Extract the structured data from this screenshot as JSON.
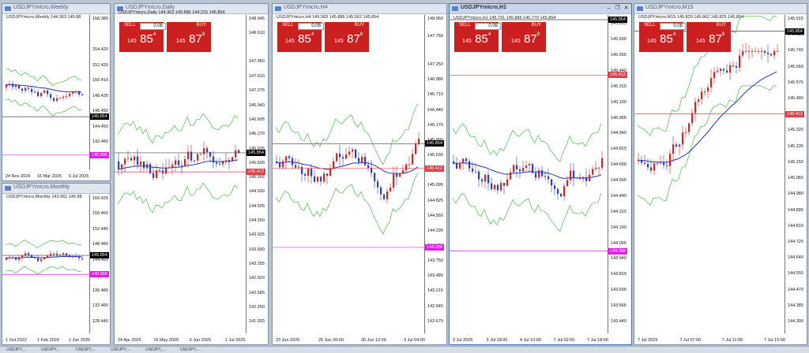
{
  "windows": {
    "weekly": {
      "title": "USDJPYmicro,Weekly",
      "symline": "USDJPYmicro,Weekly  144.363 145.88",
      "ticks": [
        "158.380",
        "154.420",
        "152.420",
        "150.410",
        "148.430",
        "146.450",
        "144.450",
        "142.460",
        "140.470"
      ],
      "xlabels": [
        "24 Nov 2024",
        "16 Mar 2025",
        "6 Jul 2025"
      ],
      "price_tag": "145.854",
      "level_tag": "140.896"
    },
    "monthly": {
      "title": "USDJPYmicro,Monthly",
      "symline": "USDJPYmicro,Monthly  143.961 145.88",
      "ticks": [
        "160.420",
        "156.460",
        "152.440",
        "148.480",
        "144.460",
        "140.440",
        "136.480",
        "132.460",
        "128.440"
      ],
      "xlabels": [
        "1 Oct 2022",
        "1 Feb 2024",
        "1 Jun 2025"
      ],
      "price_tag": "145.854",
      "level_tag": "140.896"
    },
    "daily": {
      "title": "USDJPYmicro,Daily",
      "symline": "USDJPYmicro,Daily  144.363 145.886 144.215 145.854",
      "ticks": [
        "148.945",
        "148.610",
        "147.960",
        "147.610",
        "147.275",
        "146.940",
        "146.605",
        "146.270",
        "145.935",
        "145.600",
        "145.265",
        "144.930",
        "144.595",
        "144.260",
        "143.925",
        "143.590",
        "143.255",
        "142.920",
        "142.585",
        "142.250",
        "141.920"
      ],
      "xlabels": [
        "24 Apr 2025",
        "16 May 2025",
        "9 Jun 2025",
        "1 Jul 2025"
      ],
      "price_tag": "145.854",
      "level_tag": "145.412"
    },
    "h4": {
      "title": "USDJPYmicro,H4",
      "symline": "USDJPYmicro,H4  145.583 145.886 145.562 145.854",
      "ticks": [
        "148.060",
        "147.750",
        "147.250",
        "146.980",
        "146.710",
        "146.440",
        "146.170",
        "145.905",
        "145.635",
        "145.365",
        "145.095",
        "144.825",
        "144.560",
        "144.290",
        "144.020",
        "143.750",
        "143.485",
        "143.215",
        "142.945",
        "142.675"
      ],
      "xlabels": [
        "23 Jun 2025",
        "25 Jun 20:00",
        "30 Jun 12:00",
        "3 Jul 04:00"
      ],
      "price_tag": "145.854",
      "level_tag": "145.412",
      "level_tag2": "144.008"
    },
    "h1": {
      "title": "USDJPYmicro,H1",
      "symline": "USDJPYmicro,H1  145.791 145.886 145.770 145.854",
      "ticks": [
        "145.854",
        "145.815",
        "145.690",
        "145.565",
        "145.440",
        "145.315",
        "145.190",
        "145.065",
        "144.940",
        "144.815",
        "144.690",
        "144.565",
        "144.440",
        "144.315",
        "144.190",
        "144.065",
        "143.940",
        "143.815",
        "143.690",
        "143.565",
        "143.440"
      ],
      "xlabels": [
        "3 Jul 2025",
        "3 Jul 18:00",
        "4 Jul 10:00",
        "7 Jul 02:00",
        "7 Jul 18:00"
      ],
      "price_tag": "145.854",
      "level_tag": "145.412",
      "level_tag2": "144.008"
    },
    "m15": {
      "title": "USDJPYmicro,M15",
      "symline": "USDJPYmicro,M15  145.829 145.862 145.825 145.854",
      "ticks": [
        "145.915",
        "145.830",
        "145.745",
        "145.660",
        "145.575",
        "145.490",
        "145.405",
        "145.320",
        "145.235",
        "145.150",
        "145.065",
        "144.980",
        "144.895",
        "144.810",
        "144.725",
        "144.640",
        "144.555",
        "144.470",
        "144.385",
        "144.300"
      ],
      "xlabels": [
        "7 Jul 2025",
        "7 Jul 07:00",
        "7 Jul 11:00",
        "7 Jul 15:00"
      ],
      "price_tag": "145.854",
      "level_tag": "145.412"
    }
  },
  "trade_panel": {
    "sell_label": "SELL",
    "buy_label": "BUY",
    "lot": "0.05",
    "bid_prefix": "145",
    "bid_big": "85",
    "bid_sup": "4",
    "ask_prefix": "145",
    "ask_big": "87",
    "ask_sup": "8"
  },
  "taskbar": {
    "tabs": [
      "USDJPY,...",
      "USDJPY,...",
      "USDJPY,...",
      "USDJPY,...",
      "USDJPY,...",
      "USDJPY,..."
    ]
  },
  "colors": {
    "bull": "#e02020",
    "bear": "#2a3fd0",
    "level": "#e0404a",
    "level2": "#e020e0",
    "price": "#000000",
    "ma_blue": "#2030c0",
    "ma_red": "#e05050",
    "band": "#30b030"
  }
}
